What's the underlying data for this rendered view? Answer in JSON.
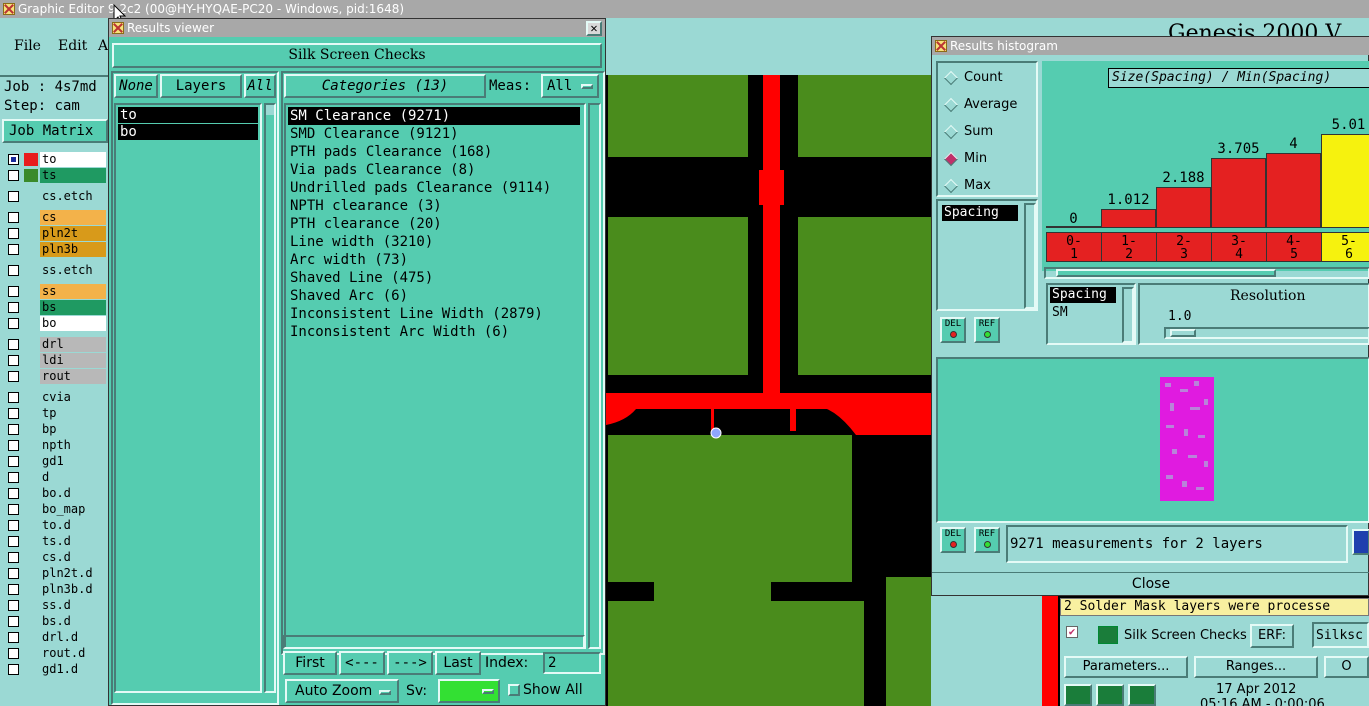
{
  "main_window": {
    "title": "Graphic Editor 9.2c2 (00@HY-HYQAE-PC20 - Windows, pid:1648)",
    "menu": [
      "File",
      "Edit",
      "A"
    ],
    "job_label": "Job : 4s7md",
    "step_label": "Step: cam",
    "job_matrix_label": "Job Matrix",
    "layers": [
      {
        "name": "to",
        "color": "#e81c1c",
        "bg": "#ffffff",
        "sel": true
      },
      {
        "name": "ts",
        "color": "#3a8a2a",
        "bg": "#1f9a62"
      },
      {
        "name": "cs.etch",
        "color": "",
        "bg": "#9bd9d4"
      },
      {
        "name": "cs",
        "color": "",
        "bg": "#f3b24a"
      },
      {
        "name": "pln2t",
        "color": "",
        "bg": "#d89a1a"
      },
      {
        "name": "pln3b",
        "color": "",
        "bg": "#d89a1a"
      },
      {
        "name": "ss.etch",
        "color": "",
        "bg": "#9bd9d4"
      },
      {
        "name": "ss",
        "color": "",
        "bg": "#f3b24a"
      },
      {
        "name": "bs",
        "color": "",
        "bg": "#1f9a62"
      },
      {
        "name": "bo",
        "color": "",
        "bg": "#ffffff"
      },
      {
        "name": "drl",
        "color": "",
        "bg": "#b8b8b8"
      },
      {
        "name": "ldi",
        "color": "",
        "bg": "#b8b8b8"
      },
      {
        "name": "rout",
        "color": "",
        "bg": "#b8b8b8"
      },
      {
        "name": "cvia",
        "color": "",
        "bg": "#9bd9d4"
      },
      {
        "name": "tp",
        "color": "",
        "bg": "#9bd9d4"
      },
      {
        "name": "bp",
        "color": "",
        "bg": "#9bd9d4"
      },
      {
        "name": "npth",
        "color": "",
        "bg": "#9bd9d4"
      },
      {
        "name": "gd1",
        "color": "",
        "bg": "#9bd9d4"
      },
      {
        "name": "d",
        "color": "",
        "bg": "#9bd9d4"
      },
      {
        "name": "bo.d",
        "color": "",
        "bg": "#9bd9d4"
      },
      {
        "name": "bo_map",
        "color": "",
        "bg": "#9bd9d4"
      },
      {
        "name": "to.d",
        "color": "",
        "bg": "#9bd9d4"
      },
      {
        "name": "ts.d",
        "color": "",
        "bg": "#9bd9d4"
      },
      {
        "name": "cs.d",
        "color": "",
        "bg": "#9bd9d4"
      },
      {
        "name": "pln2t.d",
        "color": "",
        "bg": "#9bd9d4"
      },
      {
        "name": "pln3b.d",
        "color": "",
        "bg": "#9bd9d4"
      },
      {
        "name": "ss.d",
        "color": "",
        "bg": "#9bd9d4"
      },
      {
        "name": "bs.d",
        "color": "",
        "bg": "#9bd9d4"
      },
      {
        "name": "drl.d",
        "color": "",
        "bg": "#9bd9d4"
      },
      {
        "name": "rout.d",
        "color": "",
        "bg": "#9bd9d4"
      },
      {
        "name": "gd1.d",
        "color": "",
        "bg": "#9bd9d4"
      }
    ],
    "genesis_label": "Genesis 2000 V"
  },
  "results_viewer": {
    "title": "Results viewer",
    "header": "Silk Screen Checks",
    "none_btn": "None",
    "layers_btn": "Layers",
    "all_btn": "All",
    "layers": [
      "to",
      "bo"
    ],
    "categories_btn": "Categories (13)",
    "meas_label": "Meas:",
    "meas_value": "All",
    "categories": [
      "SM Clearance (9271)",
      "SMD Clearance (9121)",
      "PTH pads Clearance (168)",
      "Via pads Clearance (8)",
      "Undrilled pads Clearance (9114)",
      "NPTH clearance (3)",
      "PTH clearance (20)",
      "Line width (3210)",
      "Arc width (73)",
      "Shaved Line (475)",
      "Shaved Arc (6)",
      "Inconsistent Line Width (2879)",
      "Inconsistent Arc Width (6)"
    ],
    "first_btn": "First",
    "prev_btn": "<---",
    "next_btn": "--->",
    "last_btn": "Last",
    "index_label": "Index:",
    "index_value": "2",
    "autozoom_label": "Auto Zoom",
    "sv_label": "Sv:",
    "show_all_label": "Show All"
  },
  "histogram": {
    "title": "Results histogram",
    "modes": [
      "Count",
      "Average",
      "Sum",
      "Min",
      "Max"
    ],
    "selected_mode": "Min",
    "measure_items": [
      "Spacing"
    ],
    "chart_title": "Size(Spacing) / Min(Spacing)",
    "bins": [
      "0-1",
      "1-2",
      "2-3",
      "3-4",
      "4-5",
      "5-6"
    ],
    "bin_values": [
      0,
      1.012,
      2.188,
      3.705,
      4,
      5.01
    ],
    "bin_value_labels": [
      "0",
      "1.012",
      "2.188",
      "3.705",
      "4",
      "5.01"
    ],
    "bin_colors": [
      "#e42121",
      "#e42121",
      "#e42121",
      "#e42121",
      "#e42121",
      "#f6f20e"
    ],
    "size_list": [
      "Spacing",
      "SM"
    ],
    "resolution_label": "Resolution",
    "resolution_value": "1.0",
    "del_label": "DEL",
    "ref_label": "REF",
    "measurements_text": "9271 measurements for 2 layers",
    "close_label": "Close"
  },
  "bottom_right": {
    "status_text": "2 Solder Mask layers were processe",
    "check_name": "Silk Screen Checks",
    "erf_label": "ERF:",
    "erf_value": "Silksc",
    "parameters_btn": "Parameters...",
    "ranges_btn": "Ranges...",
    "extra_btn": "O",
    "date_text": "17 Apr 2012",
    "time_text": "05:16 AM - 0:00:06"
  },
  "colors": {
    "teal": "#55ccb0",
    "panel": "#9bd9d4",
    "pcb_green": "#4a8c1c",
    "trace_red": "#ff0000",
    "highlight_magenta": "#e01be0"
  }
}
